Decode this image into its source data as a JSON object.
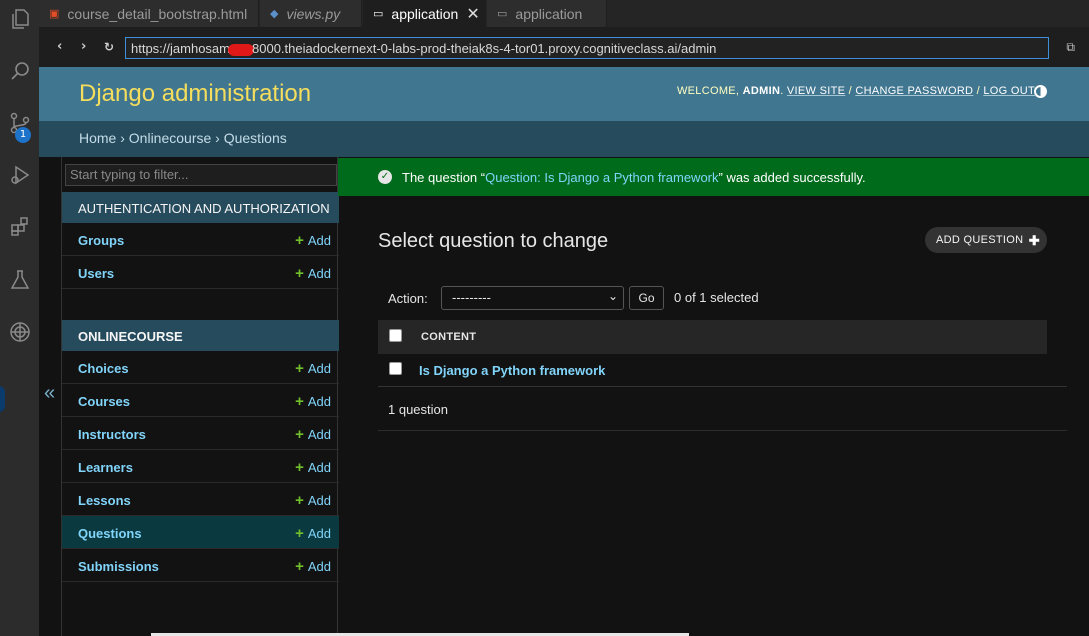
{
  "editor": {
    "tabs": [
      {
        "label": "course_detail_bootstrap.html",
        "icon": "html5-icon",
        "active": false
      },
      {
        "label": "views.py",
        "icon": "python-icon",
        "active": false
      },
      {
        "label": "application",
        "icon": "browser-preview-icon",
        "active": true
      },
      {
        "label": "application",
        "icon": "browser-preview-icon",
        "active": false
      }
    ],
    "activity_bar": {
      "icons": [
        "explorer-icon",
        "search-icon",
        "source-control-icon",
        "run-debug-icon",
        "extensions-icon",
        "testing-icon",
        "skills-network-icon"
      ],
      "source_control_badge": "1"
    },
    "collapse_icon": "«"
  },
  "browser": {
    "url_prefix": "https://jamhosam",
    "url_suffix": "8000.theiadockernext-0-labs-prod-theiak8s-4-tor01.proxy.cognitiveclass.ai/admin"
  },
  "admin": {
    "branding": "Django administration",
    "user_tools": {
      "welcome": "WELCOME,",
      "username": "ADMIN",
      "view_site": "VIEW SITE",
      "change_password": "CHANGE PASSWORD",
      "log_out": "LOG OUT"
    },
    "breadcrumbs": "Home › Onlinecourse › Questions",
    "nav": {
      "filter_placeholder": "Start typing to filter...",
      "apps": [
        {
          "caption": "AUTHENTICATION AND AUTHORIZATION",
          "models": [
            {
              "name": "Groups",
              "add": "Add"
            },
            {
              "name": "Users",
              "add": "Add"
            }
          ]
        },
        {
          "caption": "ONLINECOURSE",
          "models": [
            {
              "name": "Choices",
              "add": "Add"
            },
            {
              "name": "Courses",
              "add": "Add"
            },
            {
              "name": "Instructors",
              "add": "Add"
            },
            {
              "name": "Learners",
              "add": "Add"
            },
            {
              "name": "Lessons",
              "add": "Add"
            },
            {
              "name": "Questions",
              "add": "Add",
              "current": true
            },
            {
              "name": "Submissions",
              "add": "Add"
            }
          ]
        }
      ]
    },
    "message": {
      "prefix": "The question “",
      "link": "Question: Is Django a Python framework",
      "suffix": "” was added successfully."
    },
    "page_title": "Select question to change",
    "add_button": "ADD QUESTION",
    "actions": {
      "label": "Action:",
      "selected_option": "---------",
      "go": "Go",
      "counter": "0 of 1 selected"
    },
    "results": {
      "column": "CONTENT",
      "rows": [
        "Is Django a Python framework"
      ],
      "paginator": "1 question"
    }
  },
  "colors": {
    "header": "#417690",
    "breadcrumbs": "#264b5d",
    "branding": "#f5dd5d",
    "success": "#006b1b",
    "link": "#81d4fa",
    "add_plus": "#70bf2b"
  }
}
